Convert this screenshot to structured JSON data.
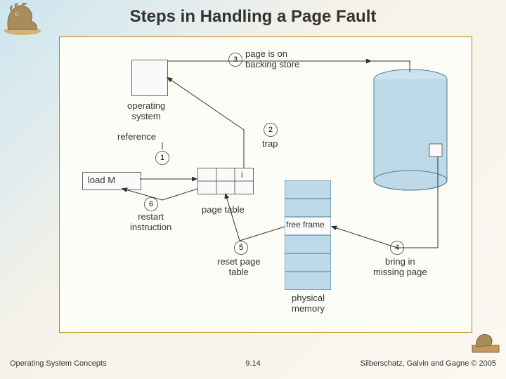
{
  "title": "Steps in Handling a Page Fault",
  "footer": {
    "left": "Operating System Concepts",
    "center": "9.14",
    "right": "Silberschatz, Galvin and Gagne © 2005"
  },
  "labels": {
    "page_on_backing": "page is on\nbacking store",
    "operating_system": "operating\nsystem",
    "reference": "reference",
    "trap": "trap",
    "load_m": "load M",
    "i": "i",
    "restart": "restart\ninstruction",
    "page_table": "page table",
    "free_frame": "free frame",
    "reset": "reset page\ntable",
    "bring_in": "bring in\nmissing page",
    "physical_memory": "physical\nmemory"
  },
  "steps": {
    "s1": "1",
    "s2": "2",
    "s3": "3",
    "s4": "4",
    "s5": "5",
    "s6": "6"
  }
}
